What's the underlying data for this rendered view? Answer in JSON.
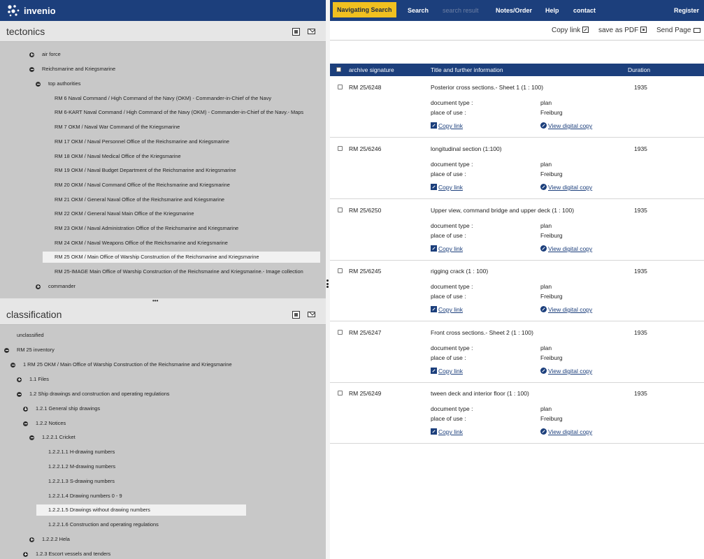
{
  "brand": {
    "name": "invenio",
    "color": "#1c3f7c",
    "accent": "#f0c020"
  },
  "nav": {
    "navigating_search": "Navigating Search",
    "search": "Search",
    "search_result": "search result",
    "notes_order": "Notes/Order",
    "help": "Help",
    "contact": "contact",
    "register": "Register"
  },
  "actions": {
    "copy_link": "Copy link",
    "save_pdf": "save as PDF",
    "send_page": "Send Page"
  },
  "tectonics": {
    "title": "tectonics",
    "nodes": [
      "air force",
      "Reichsmarine and Kriegsmarine",
      "top authorities",
      "RM 6 Naval Command / High Command of the Navy (OKM) - Commander-in-Chief of the Navy",
      "RM 6-KART Naval Command / High Command of the Navy (OKM) - Commander-in-Chief of the Navy.- Maps",
      "RM 7 OKM / Naval War Command of the Kriegsmarine",
      "RM 17 OKM / Naval Personnel Office of the Reichsmarine and Kriegsmarine",
      "RM 18 OKM / Naval Medical Office of the Kriegsmarine",
      "RM 19 OKM / Naval Budget Department of the Reichsmarine and Kriegsmarine",
      "RM 20 OKM / Naval Command Office of the Reichsmarine and Kriegsmarine",
      "RM 21 OKM / General Naval Office of the Reichsmarine and Kriegsmarine",
      "RM 22 OKM / General Naval Main Office of the Kriegsmarine",
      "RM 23 OKM / Naval Administration Office of the Reichsmarine and Kriegsmarine",
      "RM 24 OKM / Naval Weapons Office of the Reichsmarine and Kriegsmarine",
      "RM 25 OKM / Main Office of Warship Construction of the Reichsmarine and Kriegsmarine",
      "RM 25-IMAGE Main Office of Warship Construction of the Reichsmarine and Kriegsmarine.- Image collection",
      "commander"
    ]
  },
  "classification": {
    "title": "classification",
    "nodes": [
      "unclassified",
      "RM 25 inventory",
      "1 RM 25 OKM / Main Office of Warship Construction of the Reichsmarine and Kriegsmarine",
      "1.1 Files",
      "1.2 Ship drawings and construction and operating regulations",
      "1.2.1 General ship drawings",
      "1.2.2 Notices",
      "1.2.2.1 Cricket",
      "1.2.2.1.1 H-drawing numbers",
      "1.2.2.1.2 M-drawing numbers",
      "1.2.2.1.3 S-drawing numbers",
      "1.2.2.1.4 Drawing numbers 0 - 9",
      "1.2.2.1.5 Drawings without drawing numbers",
      "1.2.2.1.6 Construction and operating regulations",
      "1.2.2.2 Hela",
      "1.2.3 Escort vessels and tenders"
    ]
  },
  "table": {
    "headers": {
      "signature": "archive signature",
      "title": "Title and further information",
      "duration": "Duration"
    },
    "labels": {
      "doc_type": "document type :",
      "place": "place of use :",
      "copy_link": "Copy link",
      "view_copy": "View digital copy"
    },
    "records": [
      {
        "signature": "RM 25/6248",
        "title": "Posterior cross sections.- Sheet 1 (1 : 100)",
        "year": "1935",
        "doc_type": "plan",
        "place": "Freiburg"
      },
      {
        "signature": "RM 25/6246",
        "title": "longitudinal section (1:100)",
        "year": "1935",
        "doc_type": "plan",
        "place": "Freiburg"
      },
      {
        "signature": "RM 25/6250",
        "title": "Upper view, command bridge and upper deck (1 : 100)",
        "year": "1935",
        "doc_type": "plan",
        "place": "Freiburg"
      },
      {
        "signature": "RM 25/6245",
        "title": "rigging crack (1 : 100)",
        "year": "1935",
        "doc_type": "plan",
        "place": "Freiburg"
      },
      {
        "signature": "RM 25/6247",
        "title": "Front cross sections.- Sheet 2 (1 : 100)",
        "year": "1935",
        "doc_type": "plan",
        "place": "Freiburg"
      },
      {
        "signature": "RM 25/6249",
        "title": "tween deck and interior floor (1 : 100)",
        "year": "1935",
        "doc_type": "plan",
        "place": "Freiburg"
      }
    ]
  }
}
